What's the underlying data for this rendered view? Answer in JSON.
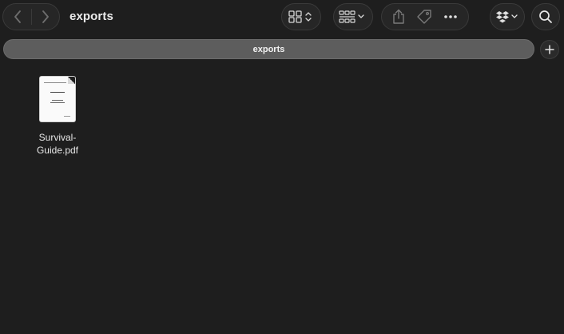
{
  "toolbar": {
    "title": "exports",
    "back_icon": "chevron-left-icon",
    "forward_icon": "chevron-right-icon",
    "view_icon": "icon-grid-icon",
    "group_icon": "group-grid-icon",
    "share_icon": "share-icon",
    "tag_icon": "tag-icon",
    "more_icon": "ellipsis-icon",
    "dropbox_icon": "dropbox-icon",
    "search_icon": "search-icon"
  },
  "tabbar": {
    "label": "exports",
    "new_tab_icon": "plus-icon"
  },
  "files": [
    {
      "name_line1": "Survival-",
      "name_line2": "Guide.pdf",
      "icon": "pdf-document-icon"
    }
  ],
  "colors": {
    "background": "#1e1e1e",
    "tabbar": "#5d5d5d",
    "text": "#e6e6e6"
  }
}
